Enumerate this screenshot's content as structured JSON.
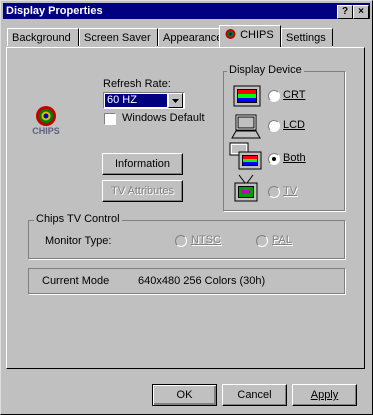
{
  "window": {
    "title": "Display Properties",
    "help_btn": "?",
    "close_btn": "×"
  },
  "tabs": [
    "Background",
    "Screen Saver",
    "Appearance",
    "CHIPS",
    "Settings"
  ],
  "active_tab": "CHIPS",
  "logo": {
    "text": "CHIPS"
  },
  "refresh": {
    "label": "Refresh Rate:",
    "value": "60 HZ",
    "windows_default_label": "Windows Default",
    "windows_default_checked": false
  },
  "buttons": {
    "information": "Information",
    "tv_attributes": "TV Attributes"
  },
  "display_device": {
    "label": "Display Device",
    "options": [
      {
        "label": "CRT",
        "selected": false,
        "enabled": true
      },
      {
        "label": "LCD",
        "selected": false,
        "enabled": true
      },
      {
        "label": "Both",
        "selected": true,
        "enabled": true
      },
      {
        "label": "TV",
        "selected": false,
        "enabled": false
      }
    ]
  },
  "tv_control": {
    "label": "Chips TV Control",
    "monitor_type_label": "Monitor Type:",
    "options": [
      {
        "label": "NTSC",
        "enabled": false
      },
      {
        "label": "PAL",
        "enabled": false
      }
    ]
  },
  "current_mode": {
    "label": "Current Mode",
    "value": "640x480 256 Colors (30h)"
  },
  "footer": {
    "ok": "OK",
    "cancel": "Cancel",
    "apply": "Apply"
  }
}
